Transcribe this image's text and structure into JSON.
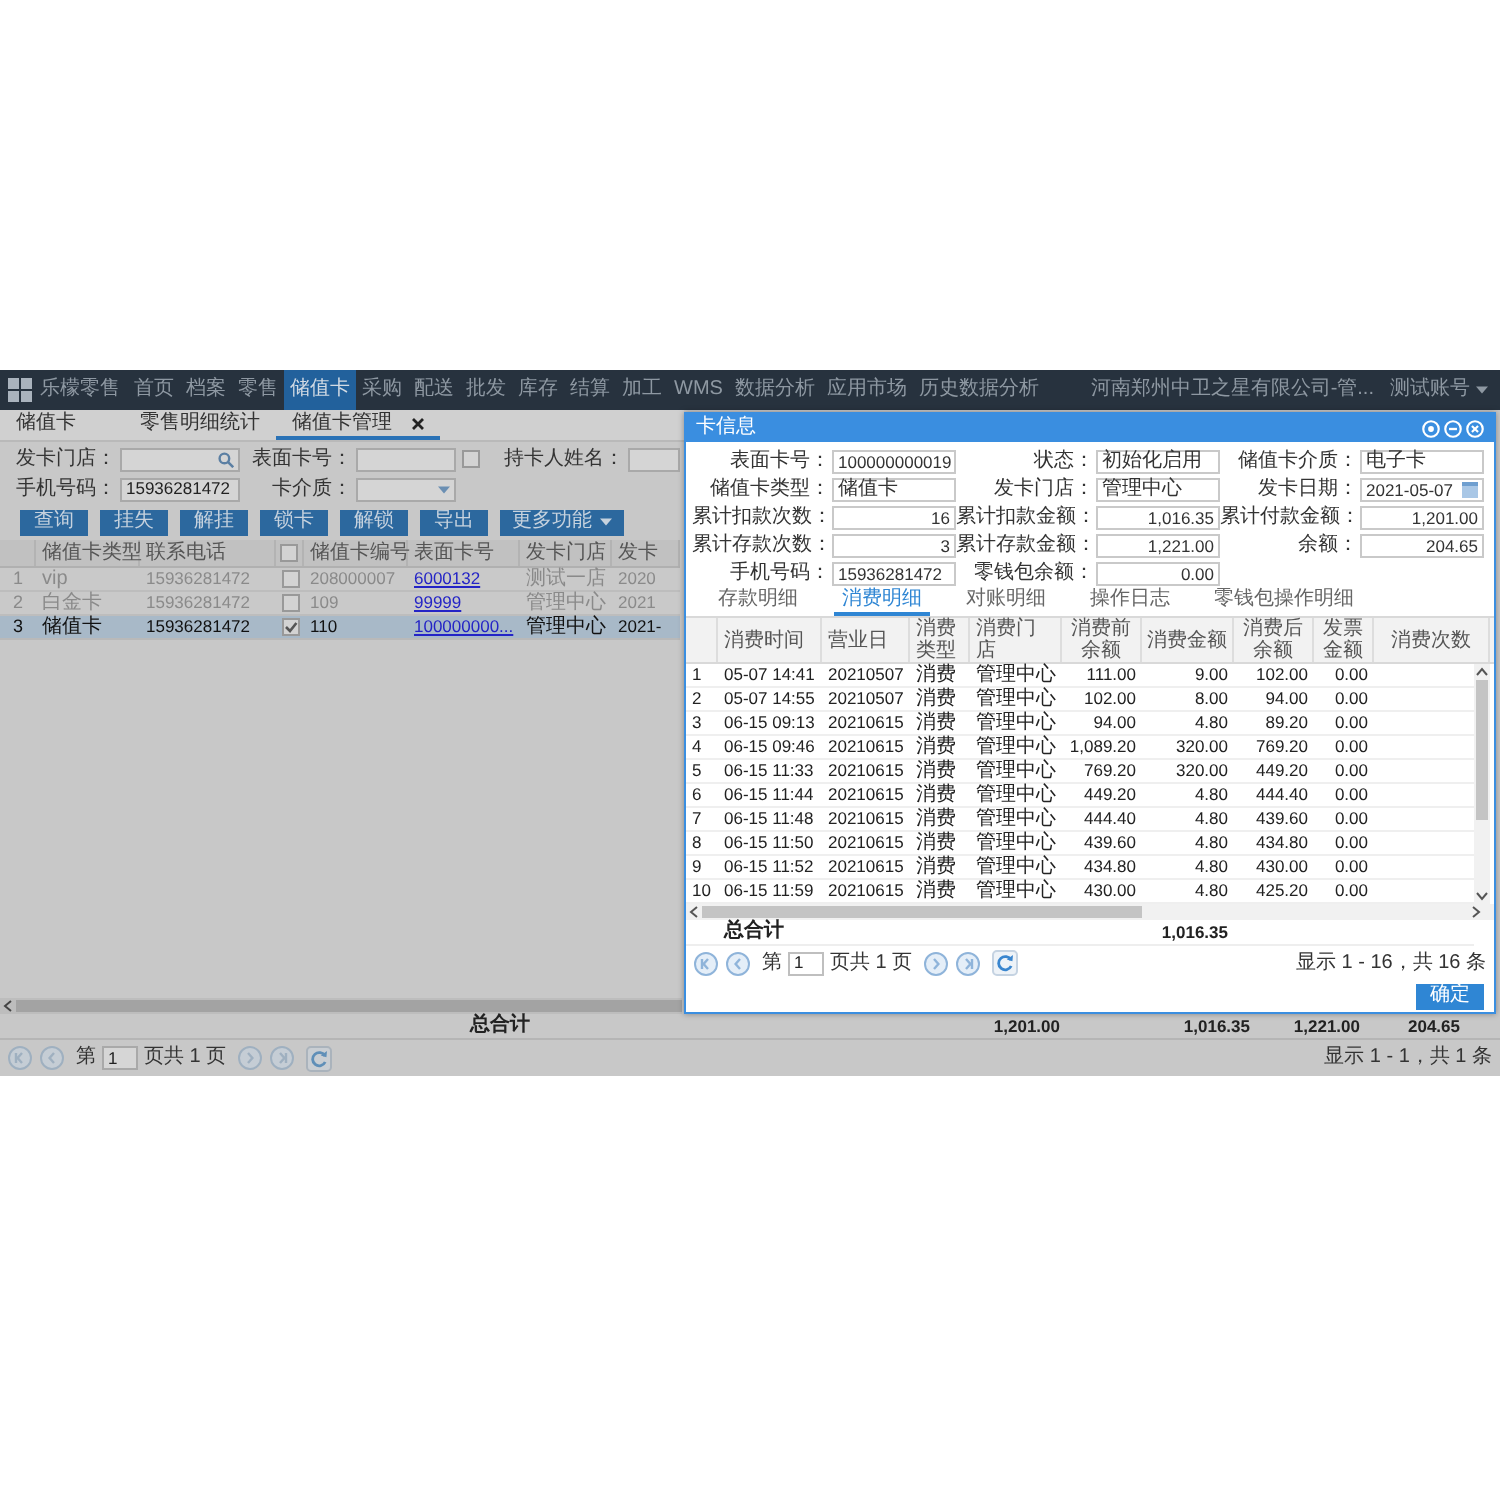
{
  "nav": {
    "brand": "乐檬零售",
    "items": [
      {
        "label": "首页",
        "selected": false
      },
      {
        "label": "档案",
        "selected": false
      },
      {
        "label": "零售",
        "selected": false
      },
      {
        "label": "储值卡",
        "selected": true
      },
      {
        "label": "采购",
        "selected": false
      },
      {
        "label": "配送",
        "selected": false
      },
      {
        "label": "批发",
        "selected": false
      },
      {
        "label": "库存",
        "selected": false
      },
      {
        "label": "结算",
        "selected": false
      },
      {
        "label": "加工",
        "selected": false
      },
      {
        "label": "WMS",
        "selected": false
      },
      {
        "label": "数据分析",
        "selected": false
      },
      {
        "label": "应用市场",
        "selected": false
      },
      {
        "label": "历史数据分析",
        "selected": false
      }
    ],
    "company": "河南郑州中卫之星有限公司-管...",
    "account": "测试账号"
  },
  "tabs": [
    {
      "label": "储值卡",
      "selected": false,
      "closable": false
    },
    {
      "label": "零售明细统计",
      "selected": false,
      "closable": false
    },
    {
      "label": "储值卡管理",
      "selected": true,
      "closable": true
    }
  ],
  "filter_rows": [
    [
      {
        "kind": "search",
        "label": "发卡门店："
      },
      {
        "kind": "text",
        "label": "表面卡号："
      },
      {
        "kind": "checkbox",
        "checked": false
      },
      {
        "kind": "text",
        "label": "持卡人姓名："
      }
    ],
    [
      {
        "kind": "text",
        "label": "手机号码：",
        "value": "15936281472"
      },
      {
        "kind": "select",
        "label": "卡介质："
      }
    ]
  ],
  "buttons": [
    {
      "kind": "button",
      "label": "查询"
    },
    {
      "kind": "button",
      "label": "挂失"
    },
    {
      "kind": "button",
      "label": "解挂"
    },
    {
      "kind": "button",
      "label": "锁卡"
    },
    {
      "kind": "button",
      "label": "解锁"
    },
    {
      "kind": "button",
      "label": "导出"
    },
    {
      "kind": "menu",
      "label": "更多功能"
    }
  ],
  "table": {
    "columns": [
      {
        "kind": "text",
        "label": "储值卡类型"
      },
      {
        "kind": "text",
        "label": "联系电话"
      },
      {
        "kind": "checkbox",
        "checked": false
      },
      {
        "kind": "text",
        "label": "储值卡编号"
      },
      {
        "kind": "text",
        "label": "表面卡号"
      },
      {
        "kind": "text",
        "label": "发卡门店"
      },
      {
        "kind": "text",
        "label": "发卡"
      }
    ],
    "rows": [
      {
        "number": "1",
        "selected": false,
        "cells": [
          {
            "kind": "text",
            "text": "vip"
          },
          {
            "kind": "code",
            "text": "15936281472"
          },
          {
            "kind": "checkbox",
            "checked": false
          },
          {
            "kind": "code",
            "text": "208000007"
          },
          {
            "kind": "link",
            "text": "6000132"
          },
          {
            "kind": "text",
            "text": "测试一店"
          },
          {
            "kind": "code",
            "text": "2020"
          }
        ]
      },
      {
        "number": "2",
        "selected": false,
        "cells": [
          {
            "kind": "text",
            "text": "白金卡"
          },
          {
            "kind": "code",
            "text": "15936281472"
          },
          {
            "kind": "checkbox",
            "checked": false
          },
          {
            "kind": "code",
            "text": "109"
          },
          {
            "kind": "link",
            "text": "99999"
          },
          {
            "kind": "text",
            "text": "管理中心"
          },
          {
            "kind": "code",
            "text": "2021"
          }
        ]
      },
      {
        "number": "3",
        "selected": true,
        "cells": [
          {
            "kind": "text",
            "text": "储值卡"
          },
          {
            "kind": "code",
            "text": "15936281472"
          },
          {
            "kind": "checkbox",
            "checked": true
          },
          {
            "kind": "code",
            "text": "110"
          },
          {
            "kind": "link",
            "text": "100000000..."
          },
          {
            "kind": "text",
            "text": "管理中心"
          },
          {
            "kind": "code",
            "text": "2021-"
          }
        ]
      }
    ]
  },
  "totals": {
    "label": "总合计",
    "values": [
      "1,201.00",
      "1,016.35",
      "1,221.00",
      "204.65"
    ]
  },
  "pager": {
    "prefix": "第",
    "page": "1",
    "suffix": "页共 1 页",
    "summary": "显示 1 - 1，共 1 条"
  },
  "dialog": {
    "title": "卡信息",
    "fields": [
      [
        {
          "kind": "code",
          "label": "表面卡号：",
          "value": "100000000019"
        },
        {
          "kind": "text",
          "label": "状态：",
          "value": "初始化启用"
        },
        {
          "kind": "text",
          "label": "储值卡介质：",
          "value": "电子卡"
        }
      ],
      [
        {
          "kind": "text",
          "label": "储值卡类型：",
          "value": "储值卡"
        },
        {
          "kind": "text",
          "label": "发卡门店：",
          "value": "管理中心"
        },
        {
          "kind": "date",
          "label": "发卡日期：",
          "value": "2021-05-07"
        }
      ],
      [
        {
          "kind": "number",
          "label": "累计扣款次数：",
          "value": "16"
        },
        {
          "kind": "number",
          "label": "累计扣款金额：",
          "value": "1,016.35"
        },
        {
          "kind": "number",
          "label": "累计付款金额：",
          "value": "1,201.00"
        }
      ],
      [
        {
          "kind": "number",
          "label": "累计存款次数：",
          "value": "3"
        },
        {
          "kind": "number",
          "label": "累计存款金额：",
          "value": "1,221.00"
        },
        {
          "kind": "number",
          "label": "余额：",
          "value": "204.65"
        }
      ],
      [
        {
          "kind": "code",
          "label": "手机号码：",
          "value": "15936281472"
        },
        {
          "kind": "number",
          "label": "零钱包余额：",
          "value": "0.00"
        }
      ]
    ],
    "tabs": [
      {
        "label": "存款明细",
        "selected": false
      },
      {
        "label": "消费明细",
        "selected": true
      },
      {
        "label": "对账明细",
        "selected": false
      },
      {
        "label": "操作日志",
        "selected": false
      },
      {
        "label": "零钱包操作明细",
        "selected": false
      }
    ],
    "table": {
      "columns": [
        {
          "kind": "code",
          "label": "消费时间"
        },
        {
          "kind": "code",
          "label": "营业日"
        },
        {
          "kind": "text",
          "label": "消费类型"
        },
        {
          "kind": "text",
          "label": "消费门店"
        },
        {
          "kind": "number",
          "label": "消费前余额"
        },
        {
          "kind": "number",
          "label": "消费金额"
        },
        {
          "kind": "number",
          "label": "消费后余额"
        },
        {
          "kind": "number",
          "label": "发票金额"
        },
        {
          "kind": "number",
          "label": "消费次数"
        }
      ],
      "rows": [
        {
          "number": "1",
          "cells": [
            "05-07 14:41",
            "20210507",
            "消费",
            "管理中心",
            "111.00",
            "9.00",
            "102.00",
            "0.00"
          ]
        },
        {
          "number": "2",
          "cells": [
            "05-07 14:55",
            "20210507",
            "消费",
            "管理中心",
            "102.00",
            "8.00",
            "94.00",
            "0.00"
          ]
        },
        {
          "number": "3",
          "cells": [
            "06-15 09:13",
            "20210615",
            "消费",
            "管理中心",
            "94.00",
            "4.80",
            "89.20",
            "0.00"
          ]
        },
        {
          "number": "4",
          "cells": [
            "06-15 09:46",
            "20210615",
            "消费",
            "管理中心",
            "1,089.20",
            "320.00",
            "769.20",
            "0.00"
          ]
        },
        {
          "number": "5",
          "cells": [
            "06-15 11:33",
            "20210615",
            "消费",
            "管理中心",
            "769.20",
            "320.00",
            "449.20",
            "0.00"
          ]
        },
        {
          "number": "6",
          "cells": [
            "06-15 11:44",
            "20210615",
            "消费",
            "管理中心",
            "449.20",
            "4.80",
            "444.40",
            "0.00"
          ]
        },
        {
          "number": "7",
          "cells": [
            "06-15 11:48",
            "20210615",
            "消费",
            "管理中心",
            "444.40",
            "4.80",
            "439.60",
            "0.00"
          ]
        },
        {
          "number": "8",
          "cells": [
            "06-15 11:50",
            "20210615",
            "消费",
            "管理中心",
            "439.60",
            "4.80",
            "434.80",
            "0.00"
          ]
        },
        {
          "number": "9",
          "cells": [
            "06-15 11:52",
            "20210615",
            "消费",
            "管理中心",
            "434.80",
            "4.80",
            "430.00",
            "0.00"
          ]
        },
        {
          "number": "10",
          "cells": [
            "06-15 11:59",
            "20210615",
            "消费",
            "管理中心",
            "430.00",
            "4.80",
            "425.20",
            "0.00"
          ]
        }
      ]
    },
    "totals": {
      "label": "总合计",
      "value": "1,016.35"
    },
    "pager": {
      "prefix": "第",
      "page": "1",
      "suffix": "页共 1 页",
      "summary": "显示 1 - 16，共 16 条"
    },
    "confirm": "确定"
  }
}
